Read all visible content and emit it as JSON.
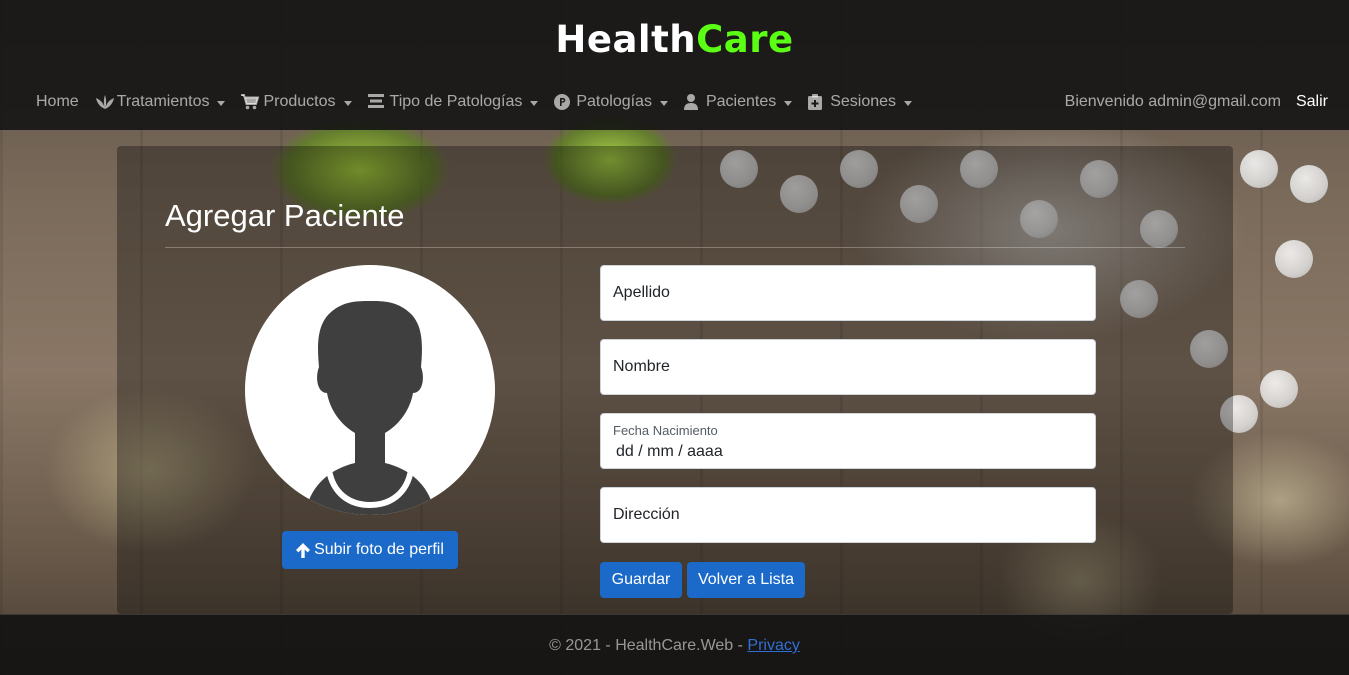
{
  "brand": {
    "part1": "Health",
    "part2": "Care"
  },
  "nav": {
    "home": "Home",
    "treatments": "Tratamientos",
    "products": "Productos",
    "pathology_types": "Tipo de Patologías",
    "pathologies": "Patologías",
    "patients": "Pacientes",
    "sessions": "Sesiones"
  },
  "user": {
    "welcome": "Bienvenido admin@gmail.com",
    "logout": "Salir"
  },
  "page": {
    "title": "Agregar Paciente"
  },
  "profile": {
    "upload_label": "Subir foto de perfil"
  },
  "form": {
    "last_name_placeholder": "Apellido",
    "first_name_placeholder": "Nombre",
    "birth_date_label": "Fecha Nacimiento",
    "birth_date_value": "dd / mm / aaaa",
    "address_placeholder": "Dirección",
    "save_label": "Guardar",
    "back_label": "Volver a Lista"
  },
  "footer": {
    "text": "© 2021 - HealthCare.Web - ",
    "privacy": "Privacy"
  },
  "colors": {
    "accent": "#1b6ac9",
    "brand_green": "#5bff14",
    "header_bg": "#121212"
  }
}
